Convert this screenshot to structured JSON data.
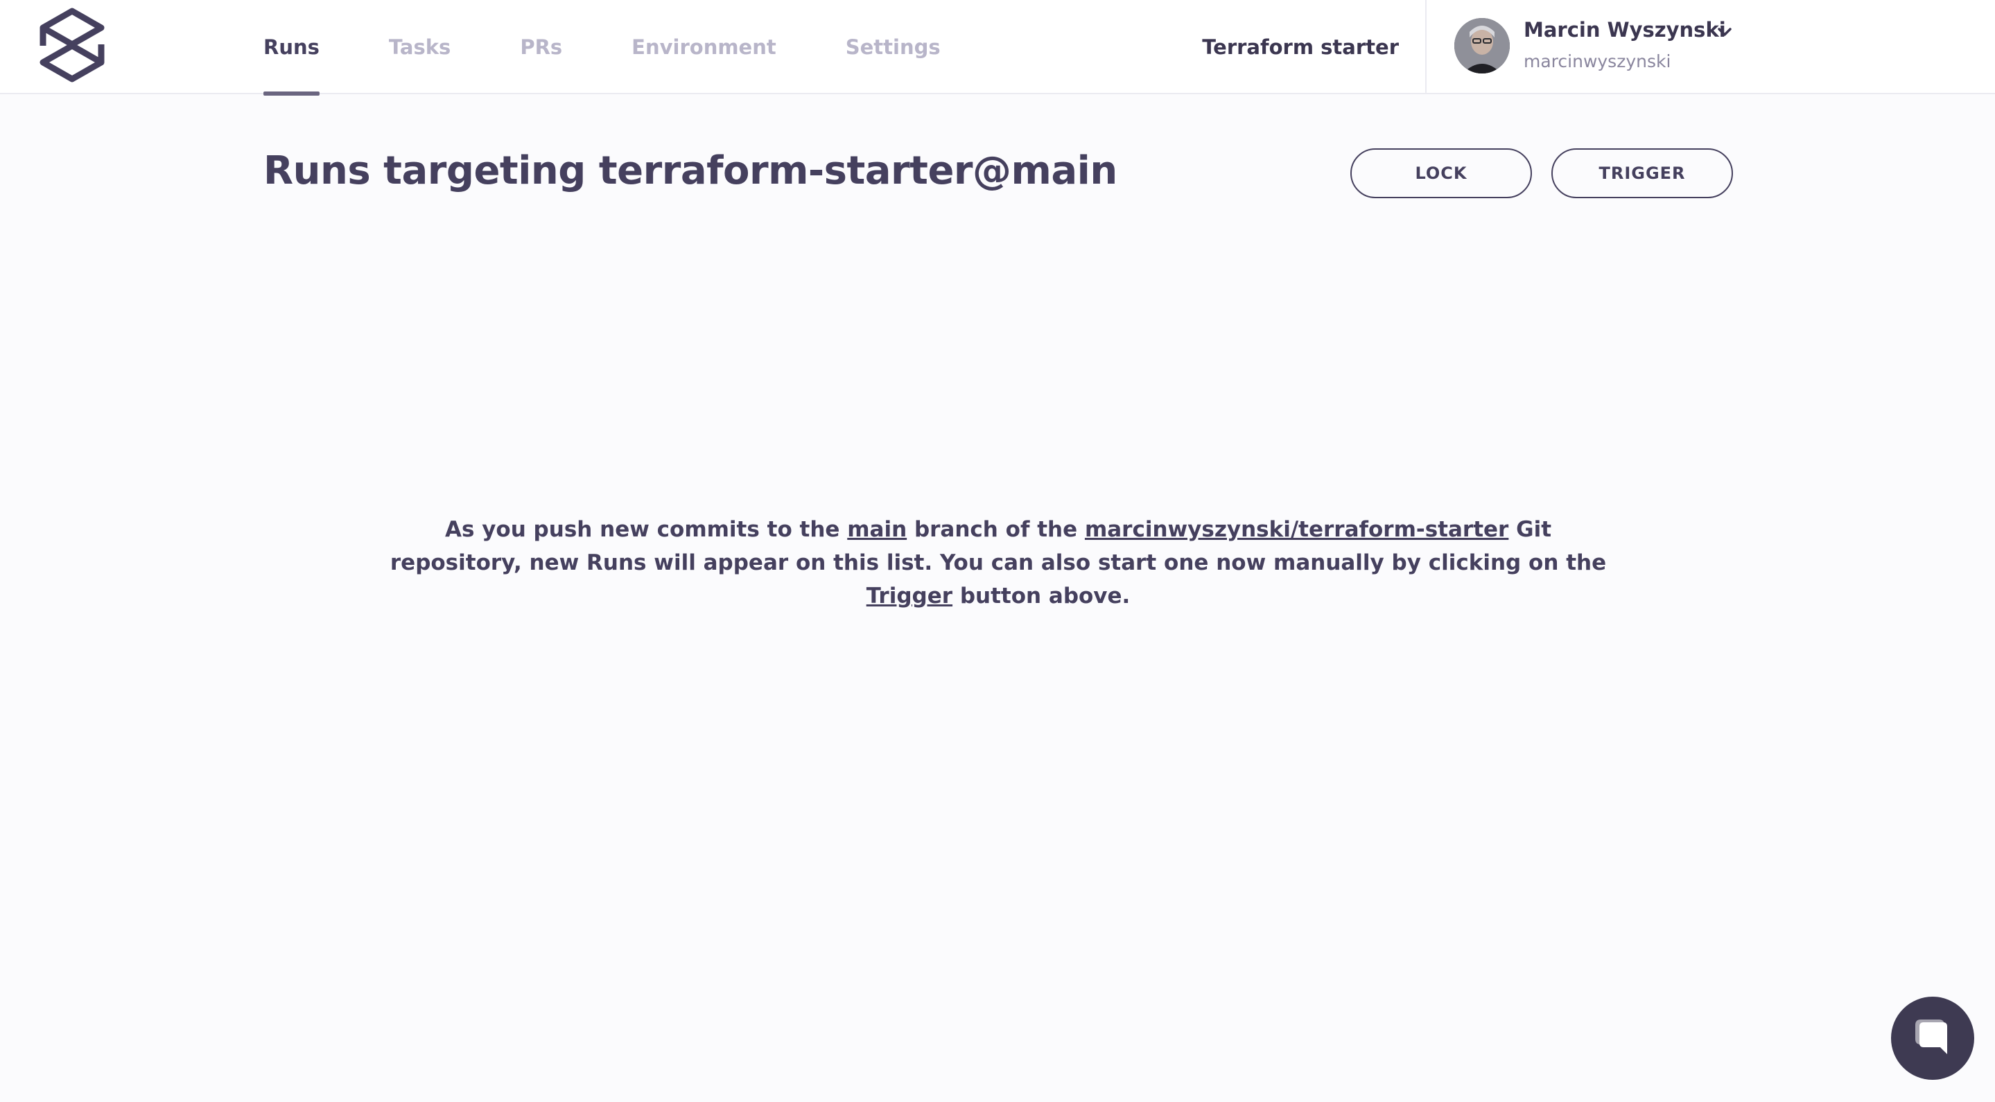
{
  "header": {
    "logo_icon": "spacelift-logo-icon",
    "nav": [
      {
        "label": "Runs",
        "active": true
      },
      {
        "label": "Tasks",
        "active": false
      },
      {
        "label": "PRs",
        "active": false
      },
      {
        "label": "Environment",
        "active": false
      },
      {
        "label": "Settings",
        "active": false
      }
    ],
    "stack_name": "Terraform starter",
    "user": {
      "name": "Marcin Wyszynski",
      "login": "marcinwyszynski",
      "avatar_icon": "avatar-photo",
      "menu_icon": "chevron-down-icon"
    }
  },
  "main": {
    "title": "Runs targeting terraform-starter@main",
    "lock_label": "LOCK",
    "trigger_label": "TRIGGER",
    "empty_state": {
      "part1": "As you push new commits to the ",
      "branch_link": "main",
      "part2": " branch of the ",
      "repo_link": "marcinwyszynski/terraform-starter",
      "part3": " Git repository, new Runs will appear on this list. You can also start one now manually by clicking on the ",
      "trigger_link": "Trigger",
      "part4": " button above."
    }
  },
  "chat": {
    "icon": "chat-bubble-icon"
  },
  "colors": {
    "text_primary": "#45405e",
    "text_muted": "#b8b5c9",
    "background": "#fbfbfd",
    "chat_button": "#3e3a52"
  }
}
